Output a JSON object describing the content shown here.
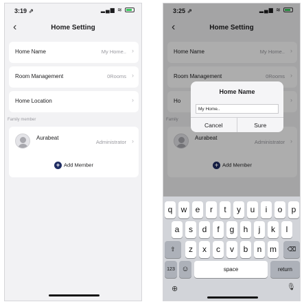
{
  "left_screen": {
    "status_time": "3:19 ⇗",
    "status_icons": "▂▄▆ ≋",
    "title": "Home Setting",
    "rows": [
      {
        "label": "Home Name",
        "value": "My Home.."
      },
      {
        "label": "Room Management",
        "value": "0Rooms"
      },
      {
        "label": "Home Location",
        "value": ""
      }
    ],
    "section_label": "Family member",
    "member": {
      "name": "Aurabeat",
      "role": "Administrator"
    },
    "add_member_label": "Add Member"
  },
  "right_screen": {
    "status_time": "3:25 ⇗",
    "status_icons": "▂▄▆ ≋",
    "title": "Home Setting",
    "rows": [
      {
        "label": "Home Name",
        "value": "My Home.."
      },
      {
        "label": "Room Management",
        "value": "0Rooms"
      },
      {
        "label": "Ho",
        "value": ""
      }
    ],
    "section_label": "Family",
    "member": {
      "name": "Aurabeat",
      "role": "Administrator"
    },
    "add_member_label": "Add Member",
    "dialog": {
      "title": "Home Name",
      "input_value": "My Home..",
      "cancel_label": "Cancel",
      "sure_label": "Sure"
    },
    "keyboard": {
      "row1": [
        "q",
        "w",
        "e",
        "r",
        "t",
        "y",
        "u",
        "i",
        "o",
        "p"
      ],
      "row2": [
        "a",
        "s",
        "d",
        "f",
        "g",
        "h",
        "j",
        "k",
        "l"
      ],
      "row3": [
        "z",
        "x",
        "c",
        "v",
        "b",
        "n",
        "m"
      ],
      "numbers_key": "123",
      "space_key": "space",
      "return_key": "return"
    }
  },
  "icons": {
    "back": "‹",
    "chevron": "›",
    "plus": "+",
    "shift": "⇧",
    "delete": "⌫",
    "emoji": "☺",
    "globe": "⊕",
    "mic": "🎙"
  },
  "colors": {
    "background": "#f2f2f4",
    "card": "#ffffff",
    "accent": "#1f2d63",
    "secondary_text": "#9a9aa0",
    "keyboard": "#d2d4d9"
  }
}
